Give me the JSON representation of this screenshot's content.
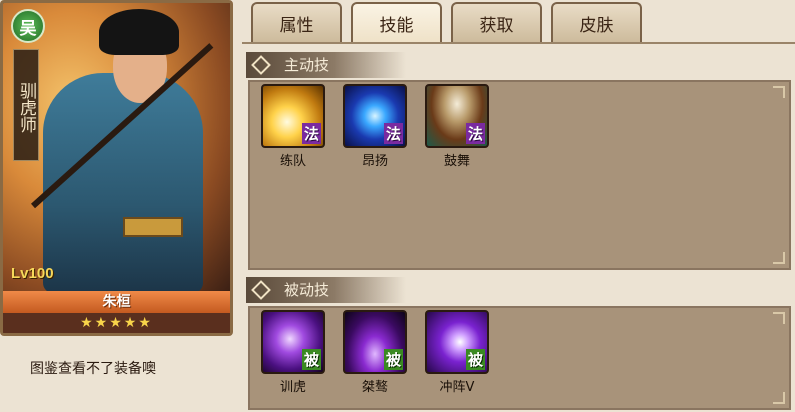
{
  "hero": {
    "faction": "吴",
    "title": "驯虎师",
    "level": "Lv100",
    "name": "朱桓",
    "stars": "★★★★★",
    "note": "图鉴查看不了装备噢"
  },
  "tabs": [
    {
      "label": "属性",
      "active": false
    },
    {
      "label": "技能",
      "active": true
    },
    {
      "label": "获取",
      "active": false
    },
    {
      "label": "皮肤",
      "active": false
    }
  ],
  "active_section": {
    "title": "主动技",
    "skills": [
      {
        "name": "练队",
        "badge": "法",
        "icon": "burst-light-icon"
      },
      {
        "name": "昂扬",
        "badge": "法",
        "icon": "blue-sigil-icon"
      },
      {
        "name": "鼓舞",
        "badge": "法",
        "icon": "war-drum-icon"
      }
    ]
  },
  "passive_section": {
    "title": "被动技",
    "skills": [
      {
        "name": "训虎",
        "badge": "被",
        "icon": "purple-beast-icon"
      },
      {
        "name": "桀骜",
        "badge": "被",
        "icon": "purple-flame-icon"
      },
      {
        "name": "冲阵Ⅴ",
        "badge": "被",
        "icon": "purple-charge-icon"
      }
    ]
  },
  "colors": {
    "background": "#ece3d3",
    "panel": "#a8937a",
    "faction_green": "#3a8a22",
    "namebar_orange": "#f08a48",
    "star_gold": "#f8d44a"
  }
}
